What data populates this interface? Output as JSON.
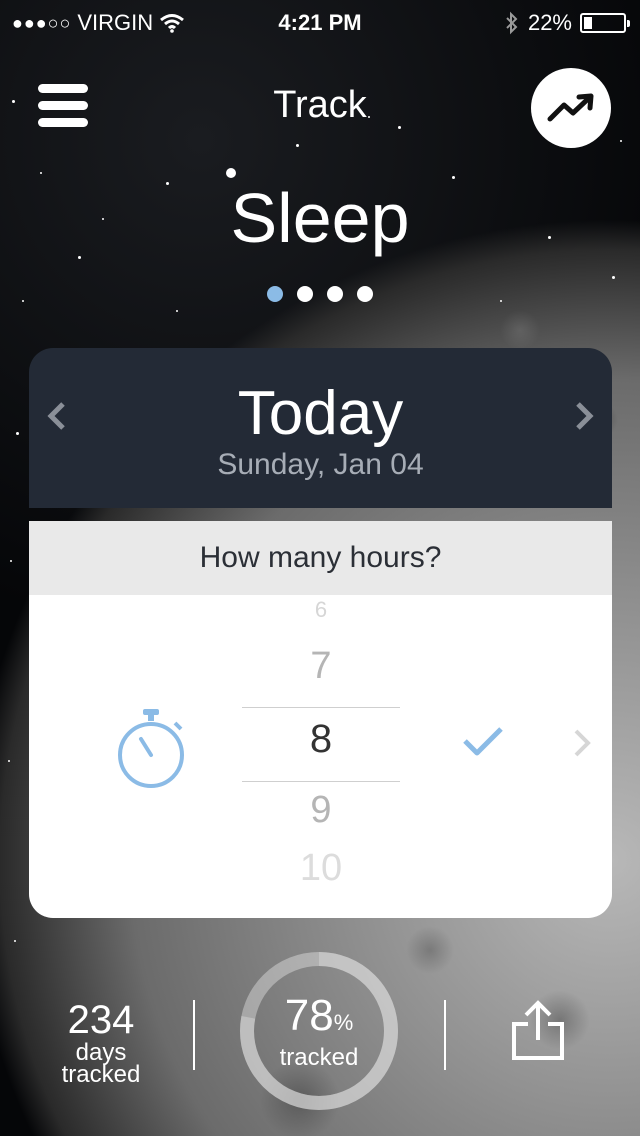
{
  "status_bar": {
    "signal_dots": "●●●○○",
    "carrier": "VIRGIN",
    "time": "4:21 PM",
    "battery_percent": "22%",
    "battery_level": 0.22
  },
  "header": {
    "title": "Track"
  },
  "category": {
    "title": "Sleep",
    "page_count": 4,
    "active_page": 1
  },
  "card": {
    "day_title": "Today",
    "date": "Sunday, Jan 04",
    "question": "How many hours?",
    "picker": {
      "values": [
        "6",
        "7",
        "8",
        "9",
        "10"
      ],
      "selected": "8"
    }
  },
  "stats": {
    "days_count": "234",
    "days_label_1": "days",
    "days_label_2": "tracked",
    "percent": "78",
    "percent_sign": "%",
    "percent_value": 0.78,
    "percent_label": "tracked"
  },
  "colors": {
    "accent": "#8bbbe6",
    "card_header": "#232a36",
    "question_bg": "#e9e9e9"
  },
  "icons": {
    "menu": "hamburger-icon",
    "trend": "trend-up-icon",
    "stopwatch": "stopwatch-icon",
    "confirm": "checkmark-icon",
    "share": "share-icon"
  }
}
